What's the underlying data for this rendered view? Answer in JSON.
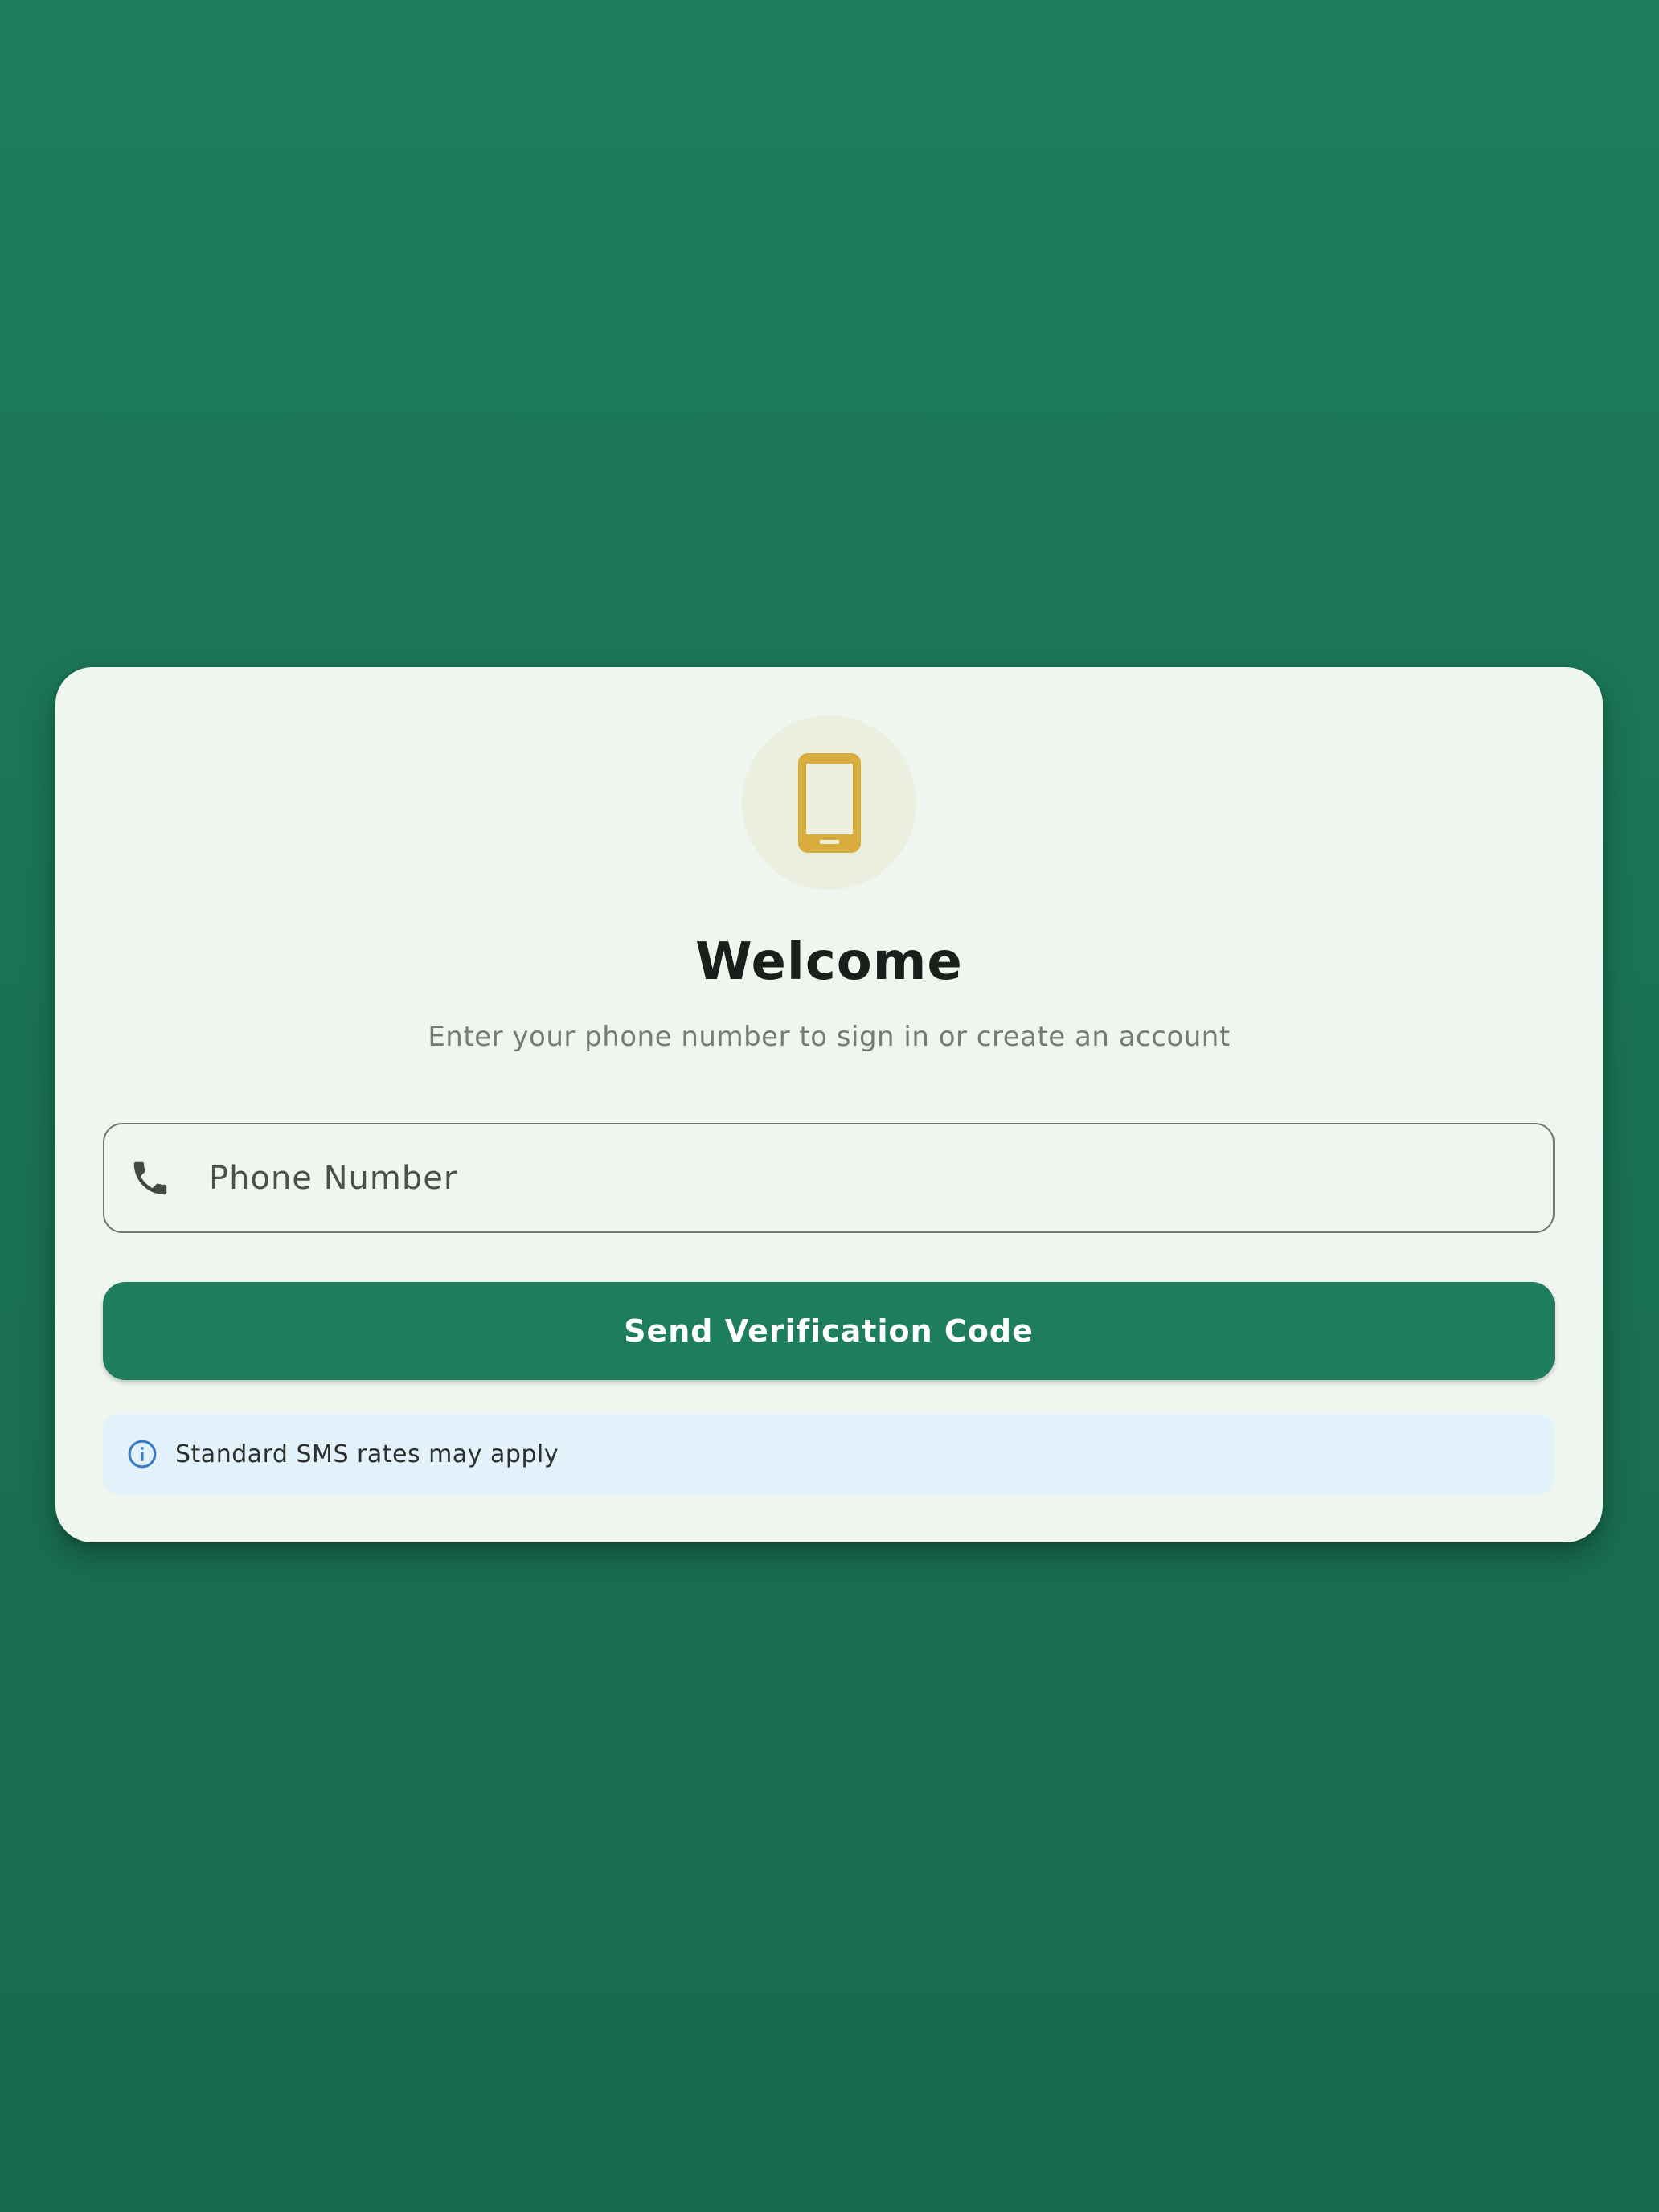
{
  "header": {
    "title": "Welcome",
    "subtitle": "Enter your phone number to sign in or create an account",
    "hero_icon": "smartphone-icon"
  },
  "phone_input": {
    "placeholder": "Phone Number",
    "value": "",
    "icon": "phone-icon"
  },
  "actions": {
    "send_label": "Send Verification Code"
  },
  "notice": {
    "icon": "info-icon",
    "text": "Standard SMS rates may apply"
  },
  "colors": {
    "background": "#1d7d5c",
    "card": "#eff6ef",
    "primary": "#1e7d5d",
    "hero_icon": "#d8ad3e",
    "hero_circle": "#ecefe0",
    "info_background": "#e3f1fb",
    "info_icon": "#3a7cc4"
  }
}
